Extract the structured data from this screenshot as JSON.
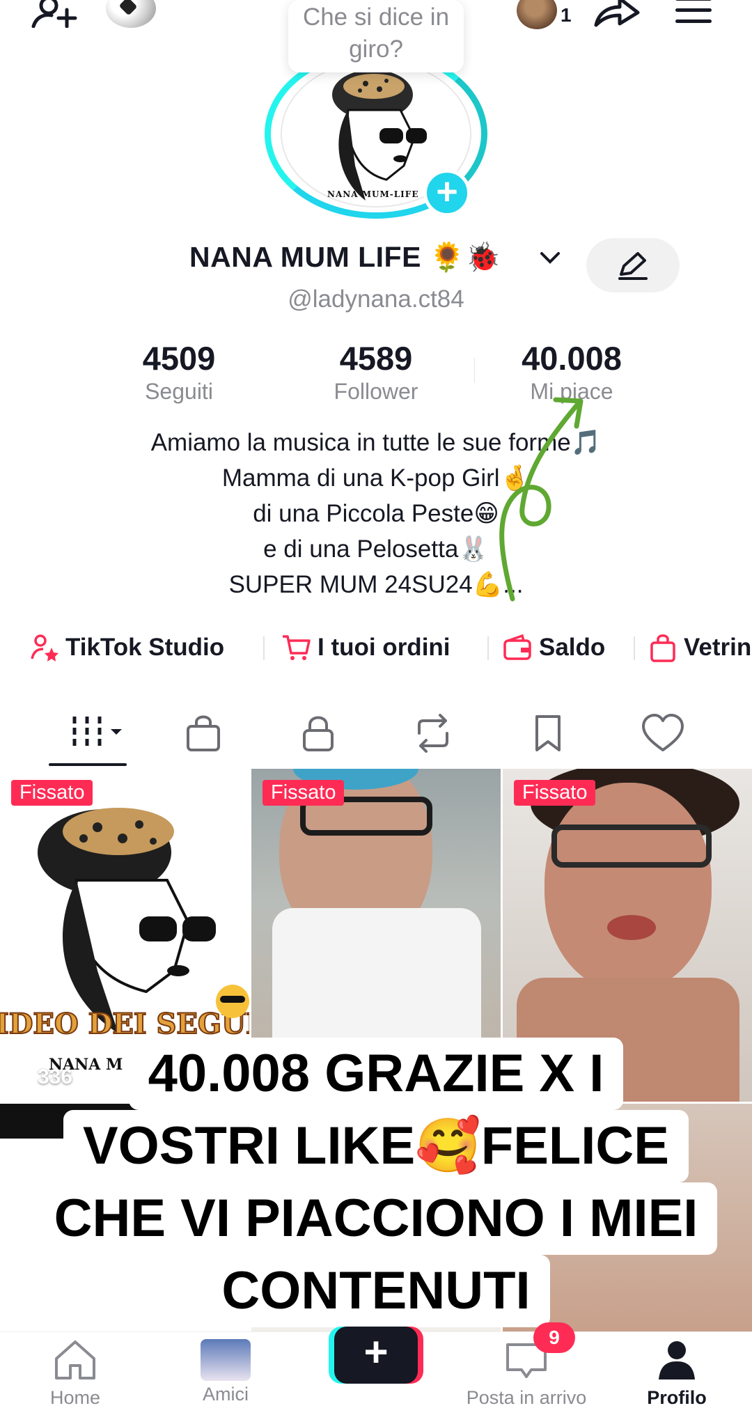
{
  "topbar": {
    "story_count": "1",
    "tooltip": "Che si dice in giro?"
  },
  "profile": {
    "avatar_brand": "NANA MUM-LIFE",
    "display_name": "NANA MUM LIFE 🌻🐞",
    "handle": "@ladynana.ct84"
  },
  "stats": [
    {
      "value": "4509",
      "label": "Seguiti"
    },
    {
      "value": "4589",
      "label": "Follower"
    },
    {
      "value": "40.008",
      "label": "Mi piace"
    }
  ],
  "bio": [
    "Amiamo la musica in tutte le sue forme🎵",
    "Mamma di una K-pop Girl🤞",
    "di una Piccola Peste😁",
    "e di una Pelosetta🐰",
    "SUPER MUM 24SU24💪..."
  ],
  "tools": [
    {
      "label": "TikTok Studio",
      "icon": "creator-star-icon"
    },
    {
      "label": "I tuoi ordini",
      "icon": "cart-icon"
    },
    {
      "label": "Saldo",
      "icon": "wallet-icon"
    },
    {
      "label": "Vetrina",
      "icon": "shopping-bag-icon"
    }
  ],
  "grid": {
    "pinned_label": "Fissato",
    "first_views": "336",
    "first_title": "IDEO DEI SEGUI",
    "first_brand": "NANA M"
  },
  "caption": [
    "40.008 GRAZIE X I",
    "VOSTRI LIKE🥰FELICE",
    "CHE VI PIACCIONO I MIEI",
    "CONTENUTI"
  ],
  "nav": {
    "home": "Home",
    "friends": "Amici",
    "inbox": "Posta in arrivo",
    "profile": "Profilo",
    "inbox_badge": "9"
  },
  "colors": {
    "accent": "#fe2c55",
    "ring": "#20d5ec",
    "muted": "#8a8b91",
    "arrow": "#5fa832"
  }
}
